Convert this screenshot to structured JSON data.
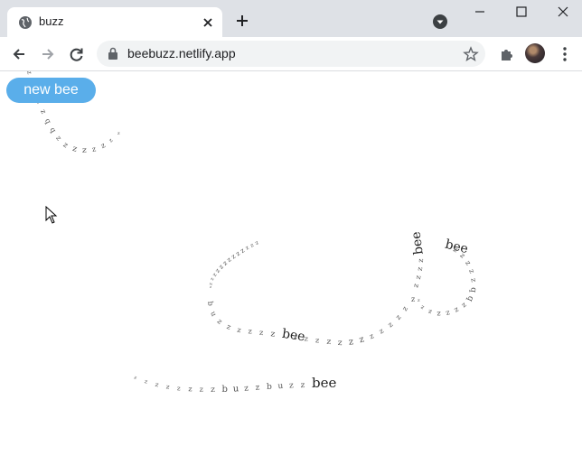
{
  "browser": {
    "tab_title": "buzz",
    "url": "beebuzz.netlify.app"
  },
  "page": {
    "new_bee_button": "new bee",
    "trails": [
      [
        "z",
        "z",
        "z",
        "z",
        "z",
        "q",
        "q",
        "z",
        "z",
        "z",
        "z",
        "z",
        "z",
        "z",
        "z"
      ],
      [
        "z",
        "z",
        "z",
        "z",
        "z",
        "z",
        "z",
        "z",
        "z",
        "z",
        "z",
        "z",
        "z",
        "z"
      ],
      [
        "b",
        "u",
        "z",
        "z",
        "z",
        "z",
        "z",
        "z",
        "bee",
        "z",
        "z",
        "z",
        "z",
        "z",
        "z",
        "z",
        "z",
        "z",
        "z",
        "z",
        "z",
        "z"
      ],
      [
        "z",
        "z",
        "z",
        "z",
        "bee",
        "bee",
        "z",
        "z",
        "z",
        "z",
        "z",
        "q",
        "q",
        "z",
        "z",
        "z",
        "z",
        "z",
        "z",
        "z"
      ],
      [
        "z",
        "z",
        "z",
        "z",
        "z",
        "z",
        "z",
        "z",
        "b",
        "u",
        "z",
        "z",
        "b",
        "u",
        "z",
        "z",
        "bee"
      ]
    ]
  }
}
